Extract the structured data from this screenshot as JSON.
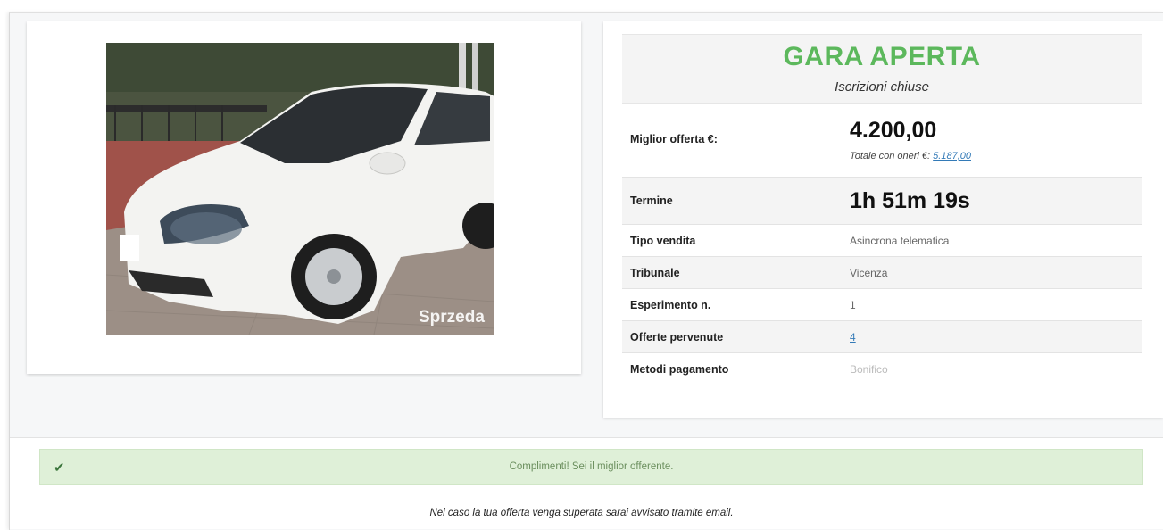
{
  "auction": {
    "status_title": "GARA APERTA",
    "status_subtitle": "Iscrizioni chiuse"
  },
  "photo": {
    "watermark": "Sprzeda",
    "subject": "white hatchback car"
  },
  "details": {
    "best_offer_label": "Miglior offerta €:",
    "best_offer_value": "4.200,00",
    "total_label": "Totale con oneri €:",
    "total_value": "5.187,00",
    "term_label": "Termine",
    "term_value": "1h 51m 19s",
    "sale_type_label": "Tipo vendita",
    "sale_type_value": "Asincrona telematica",
    "court_label": "Tribunale",
    "court_value": "Vicenza",
    "attempt_label": "Esperimento n.",
    "attempt_value": "1",
    "offers_label": "Offerte pervenute",
    "offers_value": "4",
    "payment_label": "Metodi pagamento",
    "payment_value": "Bonifico"
  },
  "alert": {
    "icon": "check-icon",
    "glyph": "✔",
    "message": "Complimenti! Sei il miglior offerente."
  },
  "footer": {
    "note": "Nel caso la tua offerta venga superata sarai avvisato tramite email."
  },
  "colors": {
    "status_green": "#5cb85c",
    "alert_bg": "#dff0d8",
    "link_blue": "#337ab7"
  }
}
